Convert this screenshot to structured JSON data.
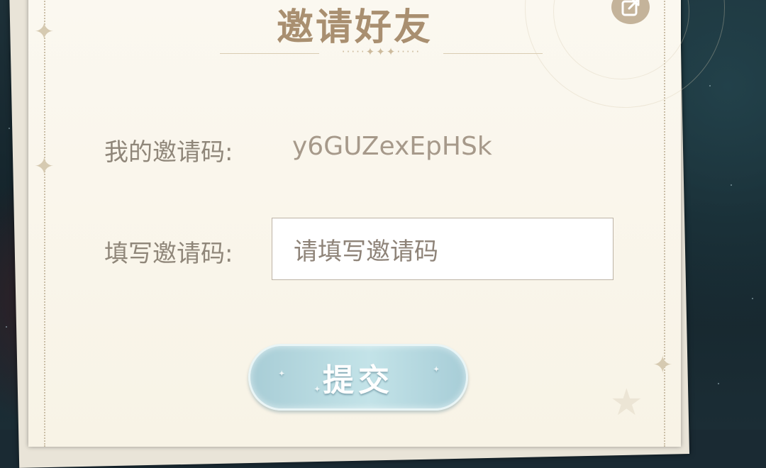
{
  "dialog": {
    "title": "邀请好友",
    "my_code_label": "我的邀请码:",
    "my_code_value": "y6GUZexEpHSk",
    "enter_code_label": "填写邀请码:",
    "enter_code_placeholder": "请填写邀请码",
    "enter_code_value": "",
    "submit_label": "提交",
    "divider_ornament": "·····✦✦✦·····",
    "icons": {
      "share": "share-external-icon",
      "sparkle": "four-point-sparkle-icon",
      "corner_star": "star-icon"
    }
  },
  "colors": {
    "title": "#a98f70",
    "label_text": "#8f8679",
    "code_text": "#a6998a",
    "card_bg": "#fbf8f0",
    "button_gradient_start": "#a8cdd6",
    "button_gradient_end": "#c3e3e8"
  }
}
